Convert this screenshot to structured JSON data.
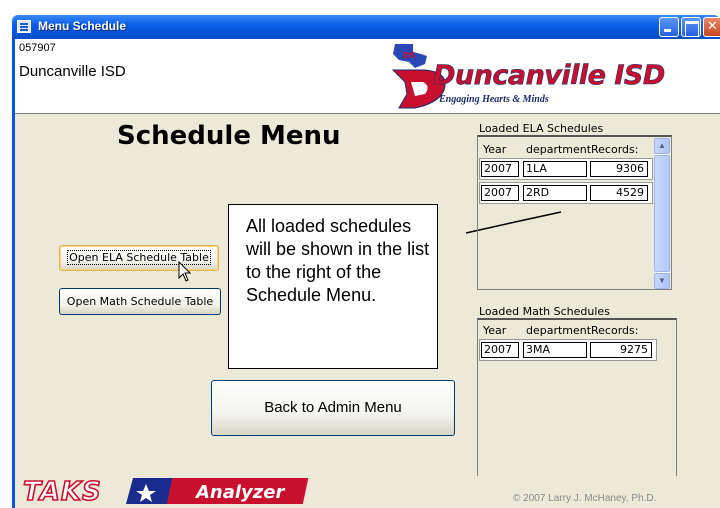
{
  "window": {
    "title": "Menu Schedule"
  },
  "header": {
    "district_code": "057907",
    "district_name": "Duncanville ISD",
    "logo_text": "Duncanville ISD",
    "logo_tagline": "Engaging Hearts & Minds"
  },
  "main": {
    "heading": "Schedule Menu",
    "ela_button": "Open ELA Schedule Table",
    "math_button": "Open Math Schedule Table",
    "back_button": "Back to Admin Menu",
    "callout": "All loaded schedules will be shown in the list to the right of the Schedule Menu."
  },
  "ela_list": {
    "label": "Loaded ELA Schedules",
    "columns": [
      "Year",
      "department",
      "Records:"
    ],
    "rows": [
      {
        "year": "2007",
        "department": "1LA",
        "records": "9306"
      },
      {
        "year": "2007",
        "department": "2RD",
        "records": "4529"
      }
    ]
  },
  "math_list": {
    "label": "Loaded Math Schedules",
    "columns": [
      "Year",
      "department",
      "Records:"
    ],
    "rows": [
      {
        "year": "2007",
        "department": "3MA",
        "records": "9275"
      }
    ]
  },
  "footer": {
    "logo_word1": "TAKS",
    "logo_word2": "Analyzer",
    "copyright": "© 2007 Larry J. McHaney, Ph.D."
  },
  "colors": {
    "titlebar": "#0a5ee8",
    "window_bg": "#ece9d8",
    "logo_red": "#c8102e",
    "logo_navy": "#1a2b6b"
  }
}
